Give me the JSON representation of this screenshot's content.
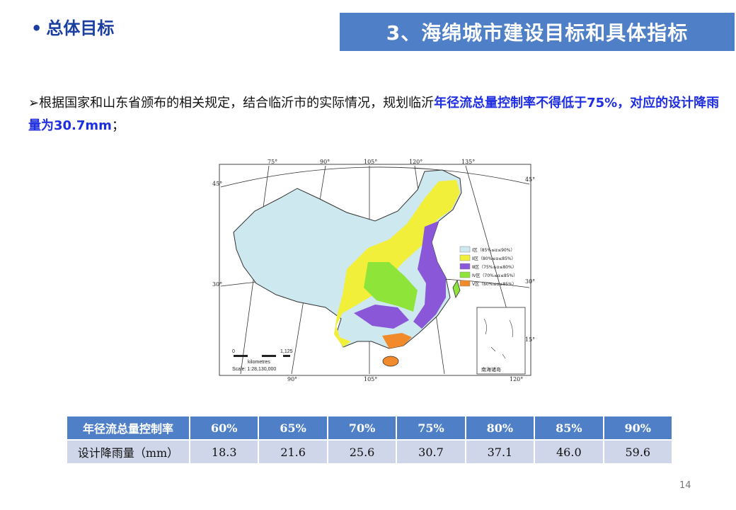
{
  "header": {
    "bullet": "•",
    "section_title": "总体目标",
    "banner_title": "3、海绵城市建设目标和具体指标"
  },
  "body": {
    "arrow": "➢",
    "plain_text": "根据国家和山东省颁布的相关规定，结合临沂市的实际情况，规划临沂",
    "highlight_text": "年径流总量控制率不得低于75%，对应的设计降雨量为30.7mm",
    "tail_text": "；"
  },
  "map": {
    "lon_labels_top": [
      "75°",
      "90°",
      "105°",
      "120°",
      "135°"
    ],
    "lon_labels_bottom": [
      "90°",
      "105°",
      "120°"
    ],
    "lat_labels": [
      "45°",
      "30°",
      "15°"
    ],
    "legend": [
      {
        "label": "Ⅰ区（85%≤α≤90%）",
        "color": "#cde8ef"
      },
      {
        "label": "Ⅱ区（80%≤α≤85%）",
        "color": "#f2ef3a"
      },
      {
        "label": "Ⅲ区（75%≤α≤80%）",
        "color": "#8a57d8"
      },
      {
        "label": "Ⅳ区（70%≤α≤85%）",
        "color": "#8fe43a"
      },
      {
        "label": "Ⅴ区（60%≤α≤85%）",
        "color": "#f08a2a"
      }
    ],
    "scale_start": "0",
    "scale_end": "1,125",
    "scale_unit": "kilometres",
    "scale_ratio": "Scale: 1:28,130,000",
    "inset_label": "南海诸岛"
  },
  "table": {
    "header_label": "年径流总量控制率",
    "rates": [
      "60%",
      "65%",
      "70%",
      "75%",
      "80%",
      "85%",
      "90%"
    ],
    "row_label": "设计降雨量（mm）",
    "rainfall": [
      "18.3",
      "21.6",
      "25.6",
      "30.7",
      "37.1",
      "46.0",
      "59.6"
    ]
  },
  "page_number": "14",
  "colors": {
    "banner": "#4f7fc6",
    "title": "#1a3fa0",
    "highlight": "#1f2ee0",
    "table_header": "#4f7fc6",
    "table_row": "#cfd6e9"
  }
}
